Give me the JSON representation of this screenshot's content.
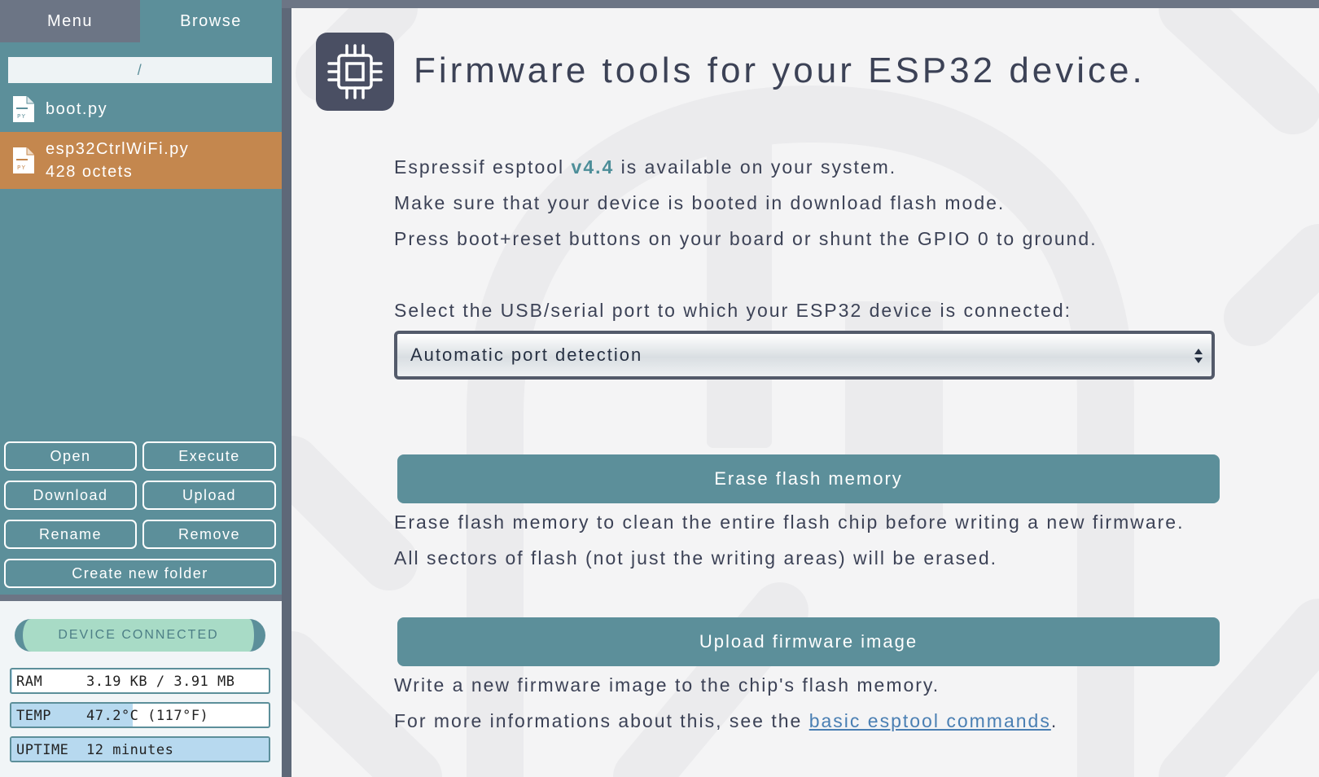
{
  "sidebar": {
    "tabs": [
      {
        "label": "Menu"
      },
      {
        "label": "Browse"
      }
    ],
    "path": "/",
    "files": [
      {
        "name": "boot.py",
        "size": ""
      },
      {
        "name": "esp32CtrlWiFi.py",
        "size": "428 octets"
      }
    ],
    "file_icon_text": "PY",
    "buttons": {
      "open": "Open",
      "execute": "Execute",
      "download": "Download",
      "upload": "Upload",
      "rename": "Rename",
      "remove": "Remove",
      "create_folder": "Create new folder"
    },
    "status": {
      "connection": "DEVICE CONNECTED",
      "stats": [
        {
          "label": "RAM",
          "value": "3.19 KB / 3.91 MB",
          "fill": 0.001
        },
        {
          "label": "TEMP",
          "value": "47.2°C (117°F)",
          "fill": 0.47
        },
        {
          "label": "UPTIME",
          "value": "12 minutes",
          "fill": 1.0
        }
      ]
    }
  },
  "main": {
    "title": "Firmware tools for your ESP32 device.",
    "intro": {
      "line1_pre": "Espressif esptool ",
      "version": "v4.4",
      "line1_post": " is available on your system.",
      "line2": "Make sure that your device is booted in download flash mode.",
      "line3": "Press boot+reset buttons on your board or shunt the GPIO 0 to ground."
    },
    "port_label": "Select the USB/serial port to which your ESP32 device is connected:",
    "port_select": "Automatic port detection",
    "erase": {
      "button": "Erase flash memory",
      "desc1": "Erase flash memory to clean the entire flash chip before writing a new firmware.",
      "desc2": "All sectors of flash (not just the writing areas) will be erased."
    },
    "upload": {
      "button": "Upload firmware image",
      "desc1": "Write a new firmware image to the chip's flash memory.",
      "desc2_pre": "For more informations about this, see the ",
      "link": "basic esptool commands",
      "desc2_post": "."
    }
  },
  "colors": {
    "sidebar": "#5c8f9a",
    "selected_file": "#c4874e",
    "accent": "#5c8f9a",
    "title": "#3c4256",
    "link": "#4a7fb3"
  }
}
